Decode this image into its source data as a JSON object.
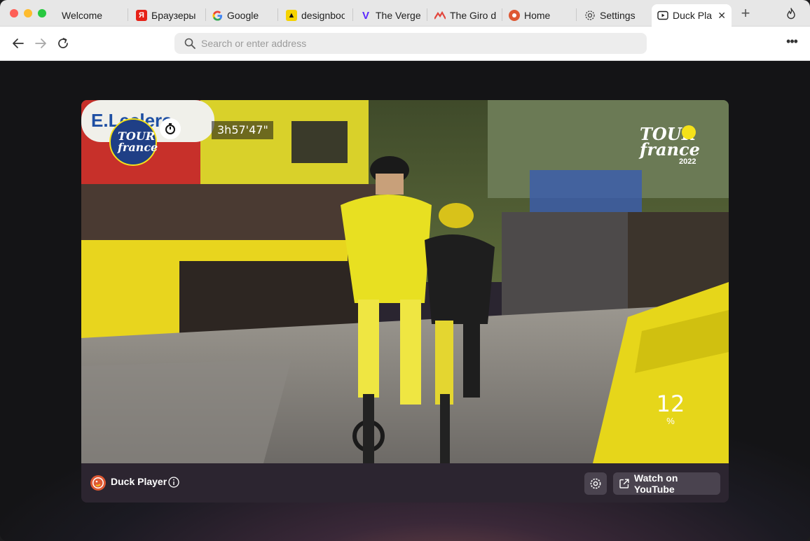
{
  "tabs": [
    {
      "label": "Welcome",
      "favicon": "none"
    },
    {
      "label": "Браузеры и",
      "favicon": "yandex-icon",
      "color": "#e62117"
    },
    {
      "label": "Google",
      "favicon": "google-icon"
    },
    {
      "label": "designboom",
      "favicon": "designboom-icon",
      "color": "#f5d300"
    },
    {
      "label": "The Verge",
      "favicon": "verge-icon",
      "color": "#5a28ff"
    },
    {
      "label": "The Giro d'",
      "favicon": "giro-icon",
      "color": "#e2463d"
    },
    {
      "label": "Home",
      "favicon": "duckduckgo-icon",
      "color": "#de5833"
    },
    {
      "label": "Settings",
      "favicon": "gear-icon"
    },
    {
      "label": "Duck Player",
      "favicon": "play-icon",
      "active": true
    }
  ],
  "address": {
    "placeholder": "Search or enter address"
  },
  "video": {
    "timer": "3h57'47\"",
    "gradient_value": "12",
    "gradient_unit": "%",
    "logo_year": "2022"
  },
  "player": {
    "title": "Duck Player",
    "watch_label": "Watch on YouTube"
  },
  "colors": {
    "accent": "#de5833",
    "player_bar": "#2c2530",
    "button": "#4a434f"
  }
}
